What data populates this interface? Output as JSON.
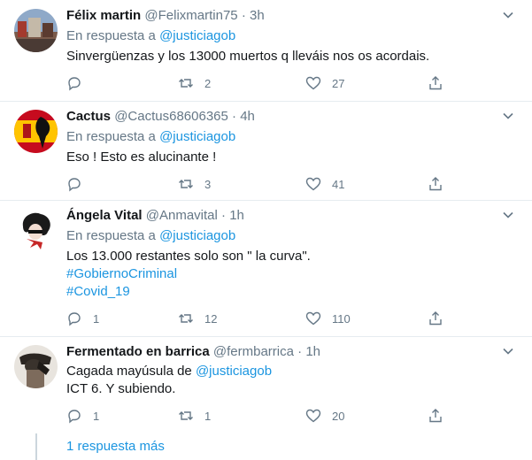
{
  "tweets": [
    {
      "name": "Félix martin",
      "handle": "@Felixmartin75",
      "separator": "·",
      "time": "3h",
      "reply_prefix": "En respuesta a",
      "reply_mention": "@justiciagob",
      "text_lines": [
        "Sinvergüenzas y los 13000 muertos q lleváis nos os acordais."
      ],
      "replies": "",
      "retweets": "2",
      "likes": "27"
    },
    {
      "name": "Cactus",
      "handle": "@Cactus68606365",
      "separator": "·",
      "time": "4h",
      "reply_prefix": "En respuesta a",
      "reply_mention": "@justiciagob",
      "text_lines": [
        "Eso ! Esto es alucinante !"
      ],
      "replies": "",
      "retweets": "3",
      "likes": "41"
    },
    {
      "name": "Ángela Vital",
      "handle": "@Anmavital",
      "separator": "·",
      "time": "1h",
      "reply_prefix": "En respuesta a",
      "reply_mention": "@justiciagob",
      "text_lines": [
        "Los 13.000 restantes solo son \" la curva\".",
        "#GobiernoCriminal",
        "#Covid_19"
      ],
      "replies": "1",
      "retweets": "12",
      "likes": "110"
    },
    {
      "name": "Fermentado en barrica",
      "handle": "@fermbarrica",
      "separator": "·",
      "time": "1h",
      "text_prefix": "Cagada mayúsula de",
      "text_mention": "@justiciagob",
      "text_line2": "ICT 6. Y subiendo.",
      "replies": "1",
      "retweets": "1",
      "likes": "20"
    }
  ],
  "more_replies": "1 respuesta más",
  "colors": {
    "link": "#1b95e0",
    "secondary": "#657786",
    "border": "#e6ecf0"
  }
}
